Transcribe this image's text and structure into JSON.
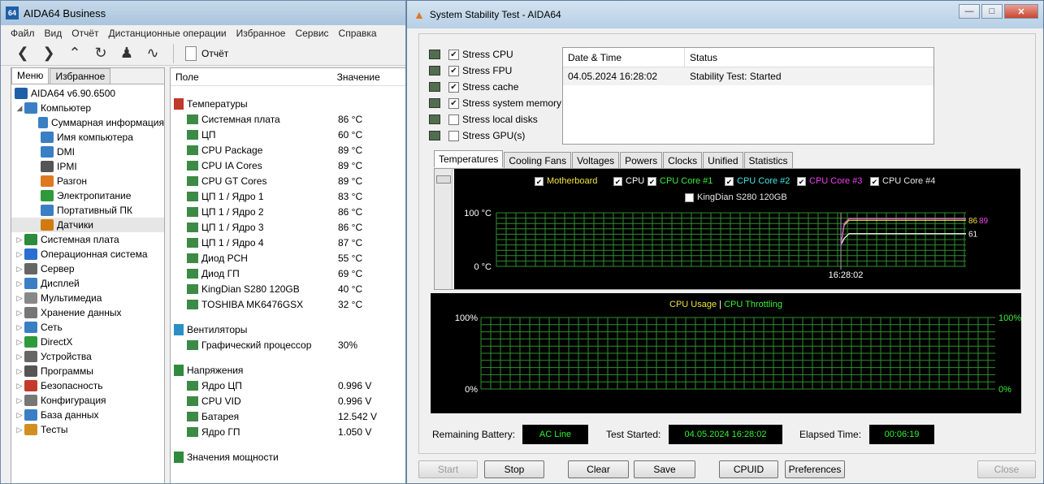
{
  "aida": {
    "title": "AIDA64 Business",
    "logo": "64",
    "menu": [
      "Файл",
      "Вид",
      "Отчёт",
      "Дистанционные операции",
      "Избранное",
      "Сервис",
      "Справка"
    ],
    "report_label": "Отчёт",
    "tabs": [
      "Меню",
      "Избранное"
    ],
    "tree_root": "AIDA64 v6.90.6500",
    "tree": [
      {
        "label": "Компьютер",
        "icon": "computer-icon",
        "level": 0,
        "expanded": true,
        "color": "#3a7fc4"
      },
      {
        "label": "Суммарная информация",
        "icon": "summary-icon",
        "level": 1,
        "color": "#3a7fc4"
      },
      {
        "label": "Имя компьютера",
        "icon": "computer-name-icon",
        "level": 1,
        "color": "#3a7fc4"
      },
      {
        "label": "DMI",
        "icon": "dmi-icon",
        "level": 1,
        "color": "#3a7fc4"
      },
      {
        "label": "IPMI",
        "icon": "ipmi-icon",
        "level": 1,
        "color": "#555555"
      },
      {
        "label": "Разгон",
        "icon": "flame-icon",
        "level": 1,
        "color": "#e07820"
      },
      {
        "label": "Электропитание",
        "icon": "power-icon",
        "level": 1,
        "color": "#2e9a3c"
      },
      {
        "label": "Портативный ПК",
        "icon": "laptop-icon",
        "level": 1,
        "color": "#3a7fc4"
      },
      {
        "label": "Датчики",
        "icon": "sensor-icon",
        "level": 1,
        "color": "#d07a10",
        "selected": true
      },
      {
        "label": "Системная плата",
        "icon": "motherboard-icon",
        "level": 0,
        "color": "#2e8a3c"
      },
      {
        "label": "Операционная система",
        "icon": "windows-icon",
        "level": 0,
        "color": "#2b6fd0"
      },
      {
        "label": "Сервер",
        "icon": "server-icon",
        "level": 0,
        "color": "#666666"
      },
      {
        "label": "Дисплей",
        "icon": "display-icon",
        "level": 0,
        "color": "#3a7fc4"
      },
      {
        "label": "Мультимедиа",
        "icon": "multimedia-icon",
        "level": 0,
        "color": "#888888"
      },
      {
        "label": "Хранение данных",
        "icon": "storage-icon",
        "level": 0,
        "color": "#777777"
      },
      {
        "label": "Сеть",
        "icon": "network-icon",
        "level": 0,
        "color": "#3a7fc4"
      },
      {
        "label": "DirectX",
        "icon": "directx-icon",
        "level": 0,
        "color": "#2e9a3c"
      },
      {
        "label": "Устройства",
        "icon": "devices-icon",
        "level": 0,
        "color": "#666666"
      },
      {
        "label": "Программы",
        "icon": "programs-icon",
        "level": 0,
        "color": "#555555"
      },
      {
        "label": "Безопасность",
        "icon": "security-icon",
        "level": 0,
        "color": "#c43a2a"
      },
      {
        "label": "Конфигурация",
        "icon": "config-icon",
        "level": 0,
        "color": "#777777"
      },
      {
        "label": "База данных",
        "icon": "database-icon",
        "level": 0,
        "color": "#3a7fc4"
      },
      {
        "label": "Тесты",
        "icon": "tests-icon",
        "level": 0,
        "color": "#d09020"
      }
    ],
    "columns": {
      "field": "Поле",
      "value": "Значение"
    },
    "groups": [
      {
        "title": "Температуры",
        "icon": "thermometer-icon",
        "rows": [
          [
            "Системная плата",
            "86 °C"
          ],
          [
            "ЦП",
            "60 °C"
          ],
          [
            "CPU Package",
            "89 °C"
          ],
          [
            "CPU IA Cores",
            "89 °C"
          ],
          [
            "CPU GT Cores",
            "89 °C"
          ],
          [
            "ЦП 1 / Ядро 1",
            "83 °C"
          ],
          [
            "ЦП 1 / Ядро 2",
            "86 °C"
          ],
          [
            "ЦП 1 / Ядро 3",
            "86 °C"
          ],
          [
            "ЦП 1 / Ядро 4",
            "87 °C"
          ],
          [
            "Диод PCH",
            "55 °C"
          ],
          [
            "Диод ГП",
            "69 °C"
          ],
          [
            "KingDian S280 120GB",
            "40 °C"
          ],
          [
            "TOSHIBA MK6476GSX",
            "32 °C"
          ]
        ]
      },
      {
        "title": "Вентиляторы",
        "icon": "fan-icon",
        "rows": [
          [
            "Графический процессор",
            "30%"
          ]
        ]
      },
      {
        "title": "Напряжения",
        "icon": "voltage-icon",
        "rows": [
          [
            "Ядро ЦП",
            "0.996 V"
          ],
          [
            "CPU VID",
            "0.996 V"
          ],
          [
            "Батарея",
            "12.542 V"
          ],
          [
            "Ядро ГП",
            "1.050 V"
          ]
        ]
      },
      {
        "title": "Значения мощности",
        "icon": "power-value-icon",
        "rows": []
      }
    ]
  },
  "sst": {
    "title": "System Stability Test - AIDA64",
    "checks": [
      {
        "label": "Stress CPU",
        "checked": true,
        "icon": "cpu-icon"
      },
      {
        "label": "Stress FPU",
        "checked": true,
        "icon": "fpu-icon"
      },
      {
        "label": "Stress cache",
        "checked": true,
        "icon": "cache-icon"
      },
      {
        "label": "Stress system memory",
        "checked": true,
        "icon": "memory-icon"
      },
      {
        "label": "Stress local disks",
        "checked": false,
        "icon": "disk-icon"
      },
      {
        "label": "Stress GPU(s)",
        "checked": false,
        "icon": "gpu-icon"
      }
    ],
    "log_header": {
      "date": "Date & Time",
      "status": "Status"
    },
    "log_rows": [
      {
        "date": "04.05.2024 16:28:02",
        "status": "Stability Test: Started"
      }
    ],
    "chart_tabs": [
      "Temperatures",
      "Cooling Fans",
      "Voltages",
      "Powers",
      "Clocks",
      "Unified",
      "Statistics"
    ],
    "legend": [
      {
        "label": "Motherboard",
        "color": "#f2e23a",
        "checked": true
      },
      {
        "label": "CPU",
        "color": "#ffffff",
        "checked": true
      },
      {
        "label": "CPU Core #1",
        "color": "#38f038",
        "checked": true
      },
      {
        "label": "CPU Core #2",
        "color": "#40e8e8",
        "checked": true
      },
      {
        "label": "CPU Core #3",
        "color": "#f040f0",
        "checked": true
      },
      {
        "label": "CPU Core #4",
        "color": "#e8e8e8",
        "checked": true
      },
      {
        "label": "KingDian S280 120GB",
        "color": "#e8e8e8",
        "checked": false
      }
    ],
    "temp_axis": {
      "top": "100 °C",
      "bottom": "0 °C",
      "time": "16:28:02"
    },
    "temp_end_labels": {
      "upper": "86",
      "upper2": "89",
      "lower": "61"
    },
    "usage_legend": {
      "usage": "CPU Usage",
      "sep": "|",
      "throttle": "CPU Throttling",
      "usage_color": "#f2e23a",
      "throttle_color": "#38f038"
    },
    "usage_axis": {
      "left_top": "100%",
      "left_bottom": "0%",
      "right_top": "100%",
      "right_bottom": "0%"
    },
    "status": {
      "battery_label": "Remaining Battery:",
      "battery_value": "AC Line",
      "started_label": "Test Started:",
      "started_value": "04.05.2024 16:28:02",
      "elapsed_label": "Elapsed Time:",
      "elapsed_value": "00:06:19"
    },
    "buttons": {
      "start": "Start",
      "stop": "Stop",
      "clear": "Clear",
      "save": "Save",
      "cpuid": "CPUID",
      "preferences": "Preferences",
      "close": "Close"
    },
    "grid_color": "#2f8f2f"
  },
  "chart_data": {
    "type": "line",
    "title": "",
    "ylim": [
      0,
      100
    ],
    "x": [
      "16:28:02"
    ],
    "series": [
      {
        "name": "Motherboard",
        "values": [
          86
        ]
      },
      {
        "name": "CPU",
        "values": [
          61
        ]
      },
      {
        "name": "CPU Core #1",
        "values": [
          89
        ]
      },
      {
        "name": "CPU Core #3",
        "values": [
          89
        ]
      }
    ]
  }
}
